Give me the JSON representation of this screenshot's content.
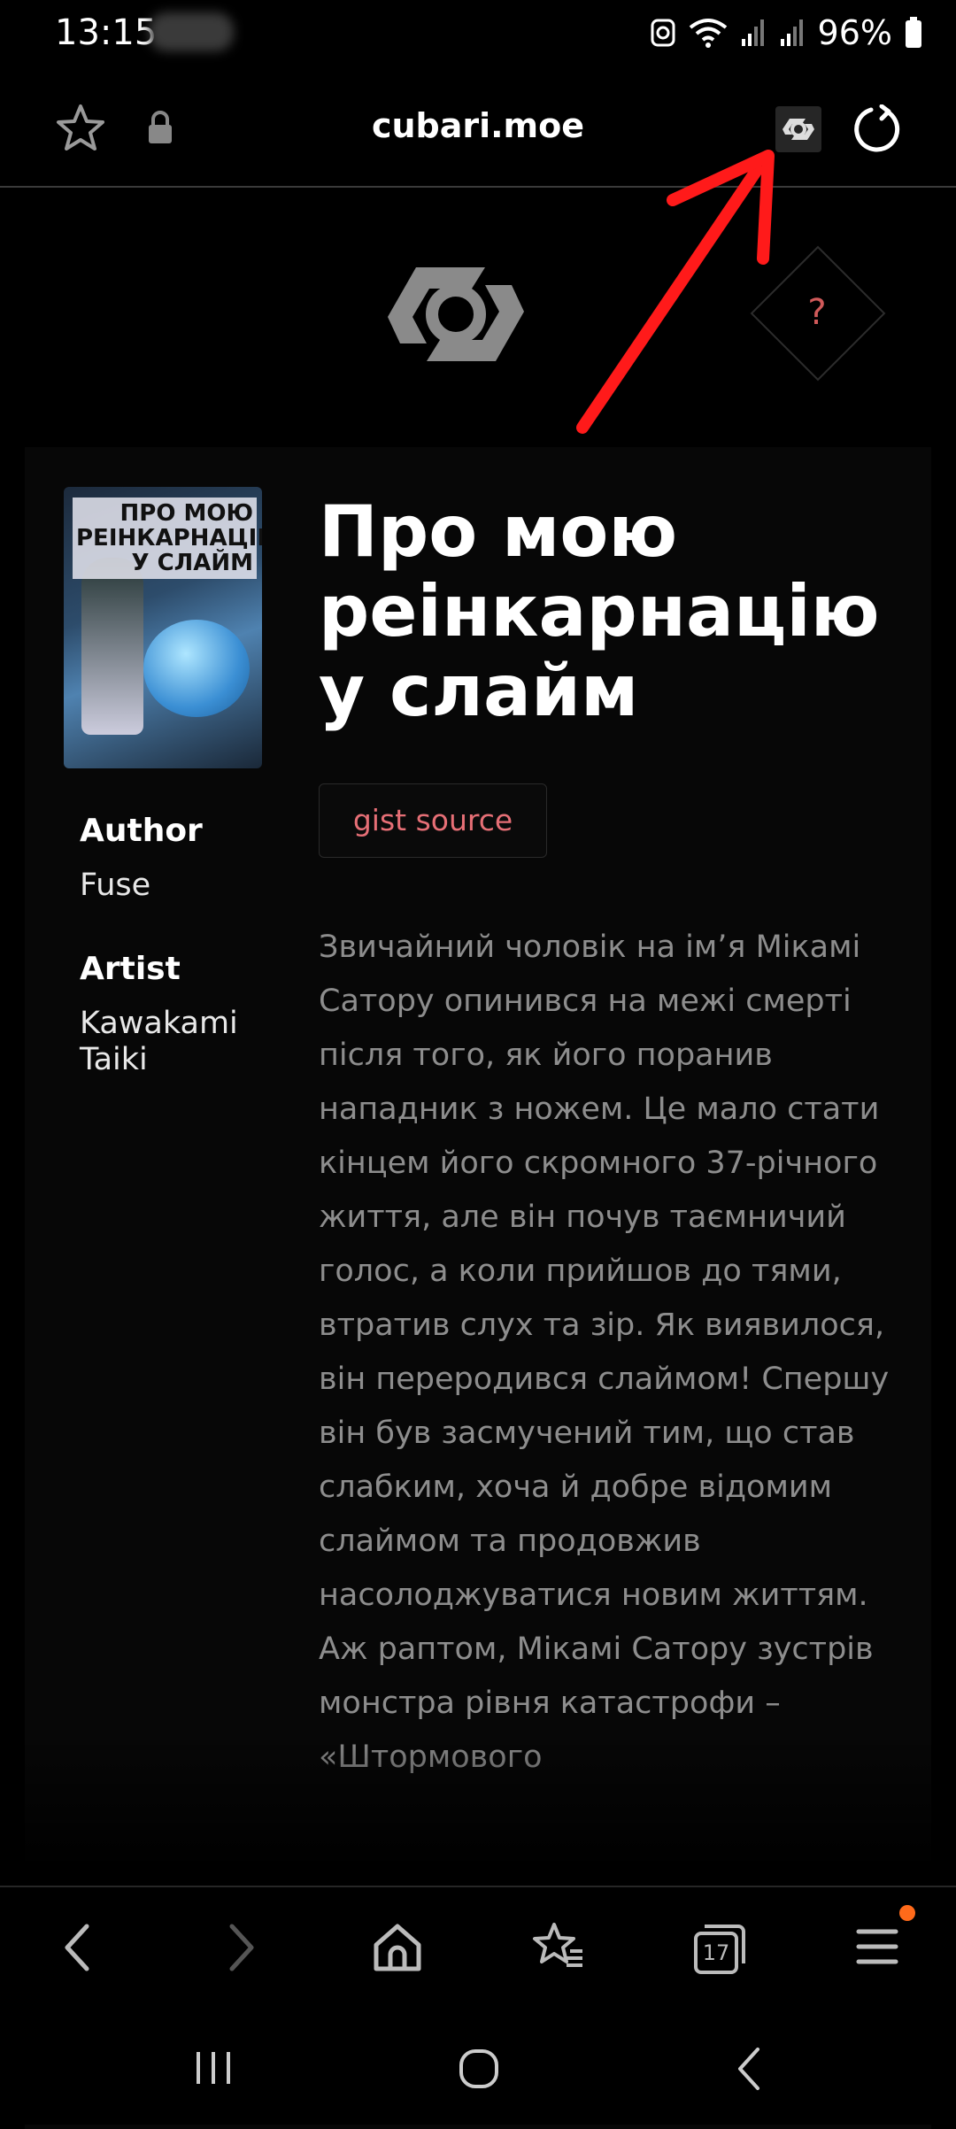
{
  "status_bar": {
    "time": "13:15",
    "battery": "96%"
  },
  "browser": {
    "url": "cubari.moe",
    "menu_badge_color": "#ff6a1a"
  },
  "site": {
    "help_label": "?"
  },
  "series": {
    "title": "Про мою реінкарнацію у слайм",
    "cover_title": "ПРО МОЮ РЕІНКАРНАЦІЮ У СЛАЙМ",
    "source_button": "gist source",
    "author_label": "Author",
    "author": "Fuse",
    "artist_label": "Artist",
    "artist": "Kawakami Taiki",
    "description": "Звичайний чоловік на ім’я Мікамі Сатору опинився на межі смерті після того, як його поранив нападник з ножем. Це мало стати кінцем його скромного 37-річного життя, але він почув таємничий голос, а коли прийшов до тями, втратив слух та зір. Як виявилося, він переродився слаймом! Спершу він був засмучений тим, що став слабким, хоча й добре відомим слаймом та продовжив насолоджуватися новим життям. Аж раптом, Мікамі Сатору зустрів монстра рівня катастрофи – «Штормового"
  },
  "nav": {
    "tabs_count": "17"
  },
  "annotation": {
    "arrow_color": "#ff1a1a"
  }
}
